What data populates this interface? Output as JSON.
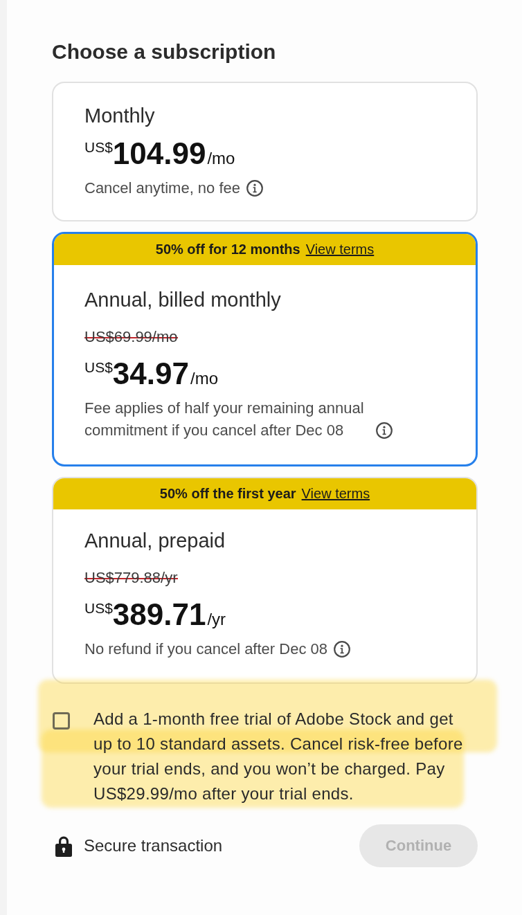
{
  "heading": "Choose a subscription",
  "plans": [
    {
      "name": "Monthly",
      "currency": "US$",
      "amount": "104.99",
      "period": "/mo",
      "note": "Cancel anytime, no fee",
      "selected": false
    },
    {
      "promo": {
        "text": "50% off for 12 months",
        "link": "View terms"
      },
      "name": "Annual, billed monthly",
      "original_price": "US$69.99/mo",
      "currency": "US$",
      "amount": "34.97",
      "period": "/mo",
      "note": "Fee applies of half your remaining annual commitment if you cancel after Dec 08",
      "selected": true
    },
    {
      "promo": {
        "text": "50% off the first year",
        "link": "View terms"
      },
      "name": "Annual, prepaid",
      "original_price": "US$779.88/yr",
      "currency": "US$",
      "amount": "389.71",
      "period": "/yr",
      "note": "No refund if you cancel after Dec 08",
      "selected": false
    }
  ],
  "addon": {
    "checked": false,
    "highlighted": true,
    "text": "Add a 1-month free trial of Adobe Stock and get up to 10 standard assets. Cancel risk-free before your trial ends, and you won’t be charged. Pay US$29.99/mo after your trial ends."
  },
  "footer": {
    "secure_label": "Secure transaction",
    "continue_button": {
      "label": "Continue",
      "disabled": true
    }
  }
}
